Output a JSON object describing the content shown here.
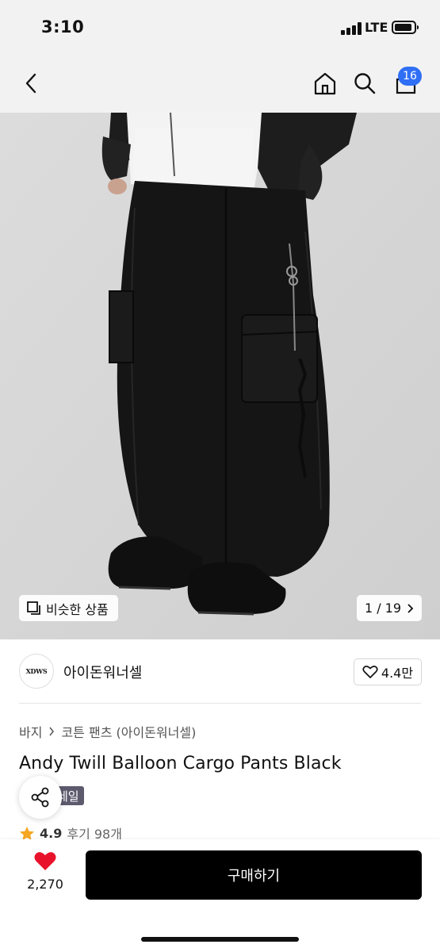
{
  "status": {
    "time": "3:10",
    "network": "LTE"
  },
  "nav": {
    "cart_count": "16",
    "icons": [
      "chevron-left-icon",
      "home-icon",
      "search-icon",
      "bag-icon"
    ]
  },
  "gallery": {
    "similar_label": "비슷한 상품",
    "pager": "1 / 19"
  },
  "brand": {
    "logo_text": "XDWS",
    "name": "아이돈워너셀",
    "likes": "4.4만"
  },
  "product": {
    "breadcrumb": [
      "바지",
      "코튼 팬츠 (아이돈워너셀)"
    ],
    "title": "Andy Twill Balloon Cargo Pants Black",
    "sale_badge": "세일",
    "rating": "4.9",
    "reviews": "후기 98개"
  },
  "bottom": {
    "wish_count": "2,270",
    "buy_label": "구매하기"
  },
  "colors": {
    "accent": "#2f6ff5",
    "buy_button": "#000000",
    "heart": "#e8132a",
    "star": "#f5a623"
  }
}
